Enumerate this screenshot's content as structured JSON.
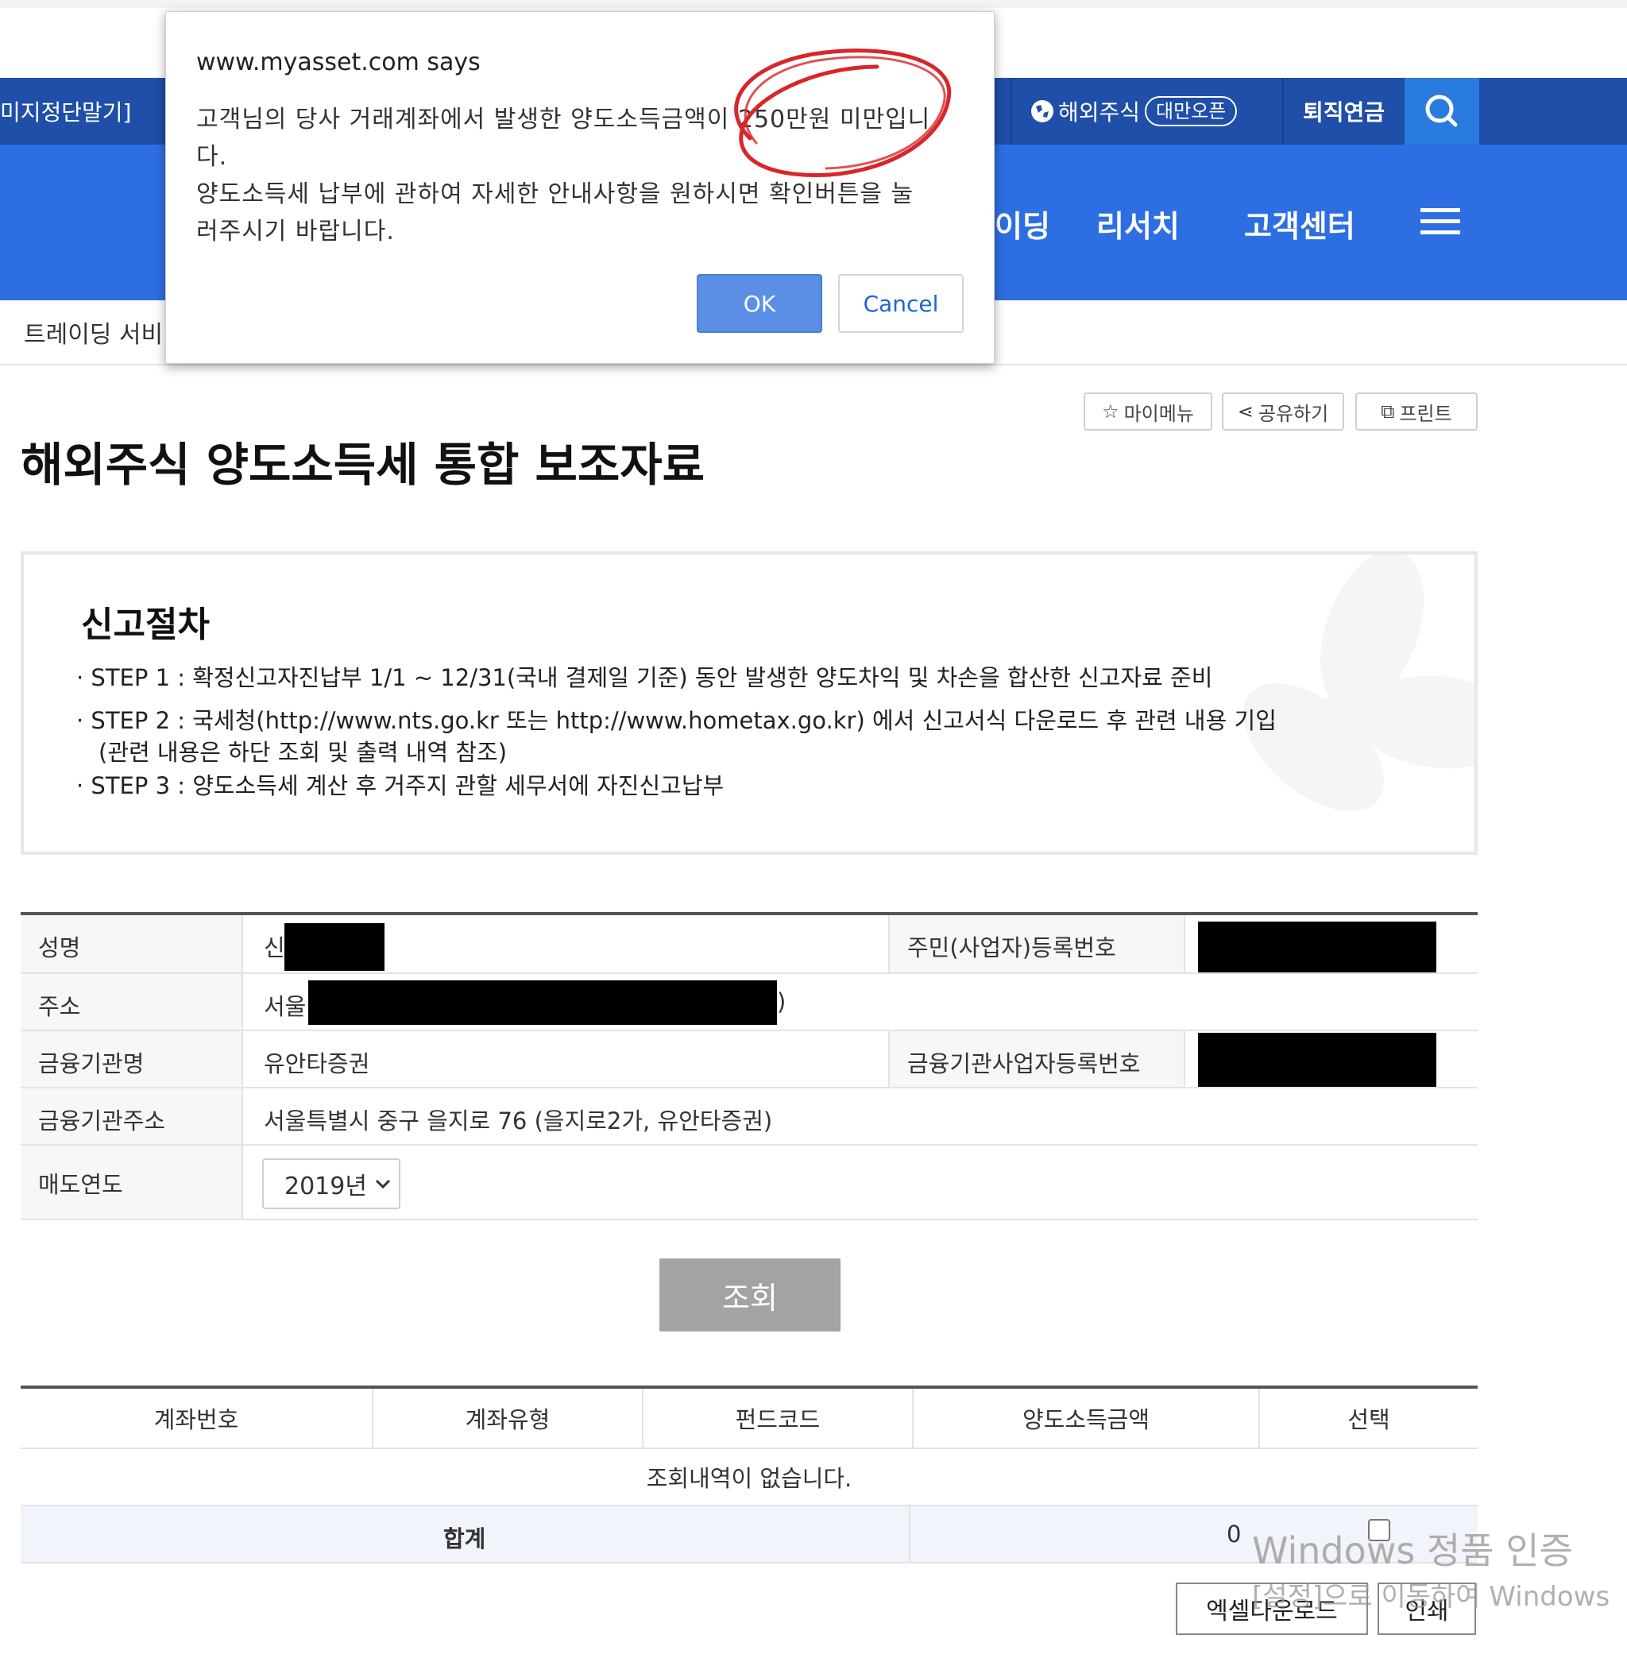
{
  "header": {
    "util_left_text": "미지정단말기]",
    "util_overseas": "해외주식",
    "util_badge": "대만오픈",
    "util_pension": "퇴직연금",
    "gnb": [
      "이딩",
      "리서치",
      "고객센터"
    ],
    "colors": {
      "util_bar": "#1f4fa8",
      "main_bar": "#2d6fe3",
      "search_box": "#2a7be0"
    }
  },
  "breadcrumb": "트레이딩 서비",
  "toolbar": {
    "mymenu": "마이메뉴",
    "share": "공유하기",
    "print": "프린트"
  },
  "page_title": "해외주식 양도소득세 통합 보조자료",
  "procedure": {
    "title": "신고절차",
    "steps": [
      "· STEP 1 : 확정신고자진납부 1/1 ~ 12/31(국내 결제일 기준) 동안 발생한 양도차익 및 차손을 합산한 신고자료 준비",
      "· STEP 2 : 국세청(http://www.nts.go.kr 또는 http://www.hometax.go.kr) 에서 신고서식 다운로드 후 관련 내용 기입",
      "(관련 내용은 하단 조회 및 출력 내역 참조)",
      "· STEP 3 : 양도소득세 계산 후 거주지 관할 세무서에 자진신고납부"
    ]
  },
  "info": {
    "name_label": "성명",
    "name_value": "신",
    "rrn_label": "주민(사업자)등록번호",
    "address_label": "주소",
    "address_value": "서울",
    "address_tail": ")",
    "fi_name_label": "금융기관명",
    "fi_name_value": "유안타증권",
    "fi_bizno_label": "금융기관사업자등록번호",
    "fi_address_label": "금융기관주소",
    "fi_address_value": "서울특별시 중구 을지로 76 (을지로2가, 유안타증권)",
    "year_label": "매도연도",
    "year_value": "2019년"
  },
  "search_button": "조회",
  "result": {
    "headers": [
      "계좌번호",
      "계좌유형",
      "펀드코드",
      "양도소득금액",
      "선택"
    ],
    "empty_message": "조회내역이 없습니다.",
    "sum_label": "합계",
    "sum_value": "0"
  },
  "footer": {
    "excel": "엑셀다운로드",
    "print": "인쇄"
  },
  "watermark": {
    "line1": "Windows 정품 인증",
    "line2": "[설정]으로 이동하여 Windows"
  },
  "dialog": {
    "title": "www.myasset.com says",
    "message": "고객님의 당사 거래계좌에서 발생한 양도소득금액이 250만원 미만입니\n다.\n양도소득세 납부에 관하여 자세한 안내사항을 원하시면 확인버튼을 눌\n러주시기 바랍니다.",
    "ok": "OK",
    "cancel": "Cancel",
    "annotation_color": "#d8262b"
  }
}
